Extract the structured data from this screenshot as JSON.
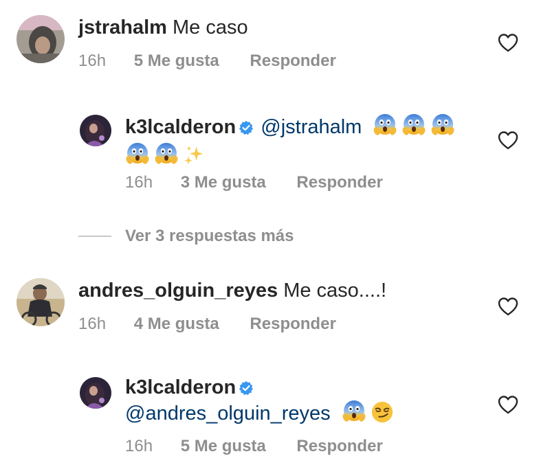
{
  "comments": [
    {
      "username": "jstrahalm",
      "text": "Me caso",
      "time": "16h",
      "likes": "5 Me gusta",
      "reply": "Responder"
    },
    {
      "username": "k3lcalderon",
      "mention": "@jstrahalm",
      "emojis": [
        "face-screaming-in-fear",
        "face-screaming-in-fear",
        "face-screaming-in-fear",
        "face-screaming-in-fear",
        "face-screaming-in-fear",
        "sparkles"
      ],
      "time": "16h",
      "likes": "3 Me gusta",
      "reply": "Responder"
    },
    {
      "username": "andres_olguin_reyes",
      "text": "Me caso....!",
      "time": "16h",
      "likes": "4 Me gusta",
      "reply": "Responder"
    },
    {
      "username": "k3lcalderon",
      "mention": "@andres_olguin_reyes",
      "emojis": [
        "face-screaming-in-fear",
        "smirking-face"
      ],
      "time": "16h",
      "likes": "5 Me gusta",
      "reply": "Responder"
    }
  ],
  "more_replies_label": "Ver 3 respuestas más",
  "colors": {
    "text": "#262626",
    "meta": "#8e8e8e",
    "mention": "#00376b",
    "verified": "#3897f0"
  }
}
